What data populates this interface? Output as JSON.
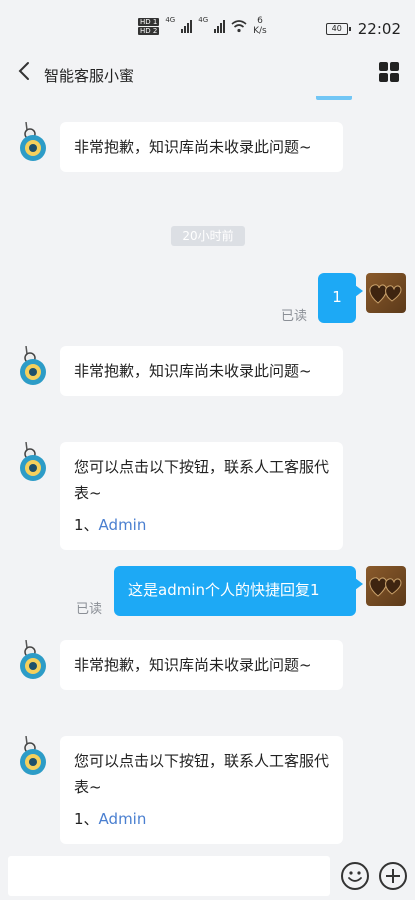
{
  "status_bar": {
    "hd1": "HD 1",
    "hd2": "HD 2",
    "net1": "4G",
    "net2": "4G",
    "speed_value": "6",
    "speed_unit": "K/s",
    "battery": "40",
    "time": "22:02"
  },
  "header": {
    "title": "智能客服小蜜"
  },
  "chat": {
    "time_divider": "20小时前",
    "read_label": "已读",
    "messages": [
      {
        "from": "bot",
        "text": "非常抱歉，知识库尚未收录此问题~"
      },
      {
        "from": "user",
        "text": "1"
      },
      {
        "from": "bot",
        "text": "非常抱歉，知识库尚未收录此问题~"
      },
      {
        "from": "bot",
        "text": "您可以点击以下按钮，联系人工客服代表~",
        "link_prefix": "1、",
        "link_text": "Admin"
      },
      {
        "from": "user",
        "text": "这是admin个人的快捷回复1"
      },
      {
        "from": "bot",
        "text": "非常抱歉，知识库尚未收录此问题~"
      },
      {
        "from": "bot",
        "text": "您可以点击以下按钮，联系人工客服代表~",
        "link_prefix": "1、",
        "link_text": "Admin"
      }
    ]
  },
  "input_bar": {
    "value": "",
    "emoji_icon": "emoji-icon",
    "plus_icon": "plus-icon"
  },
  "colors": {
    "user_bubble": "#1da9f5",
    "link": "#4a7fd0",
    "background": "#f2f3f5"
  }
}
